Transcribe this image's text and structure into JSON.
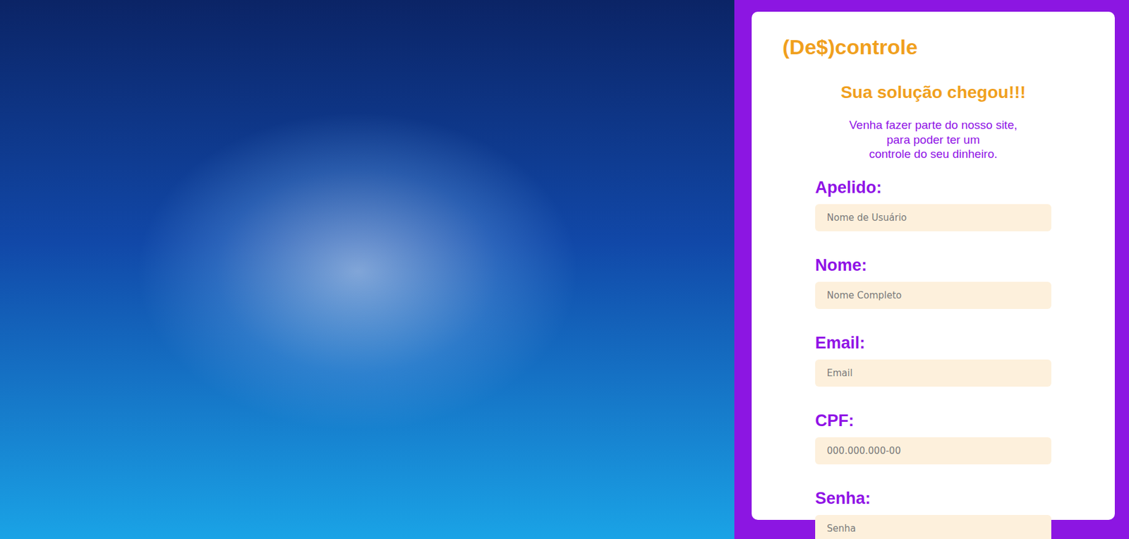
{
  "brand": {
    "logo": "(De$)controle"
  },
  "headline": "Sua solução chegou!!!",
  "intro": [
    "Venha fazer parte do nosso site,",
    "para poder ter um",
    "controle do seu dinheiro."
  ],
  "fields": [
    {
      "label": "Apelido:",
      "placeholder": "Nome de Usuário",
      "type": "text"
    },
    {
      "label": "Nome:",
      "placeholder": "Nome Completo",
      "type": "text"
    },
    {
      "label": "Email:",
      "placeholder": "Email",
      "type": "email"
    },
    {
      "label": "CPF:",
      "placeholder": "000.000.000-00",
      "type": "text"
    },
    {
      "label": "Senha:",
      "placeholder": "Senha",
      "type": "password"
    }
  ]
}
